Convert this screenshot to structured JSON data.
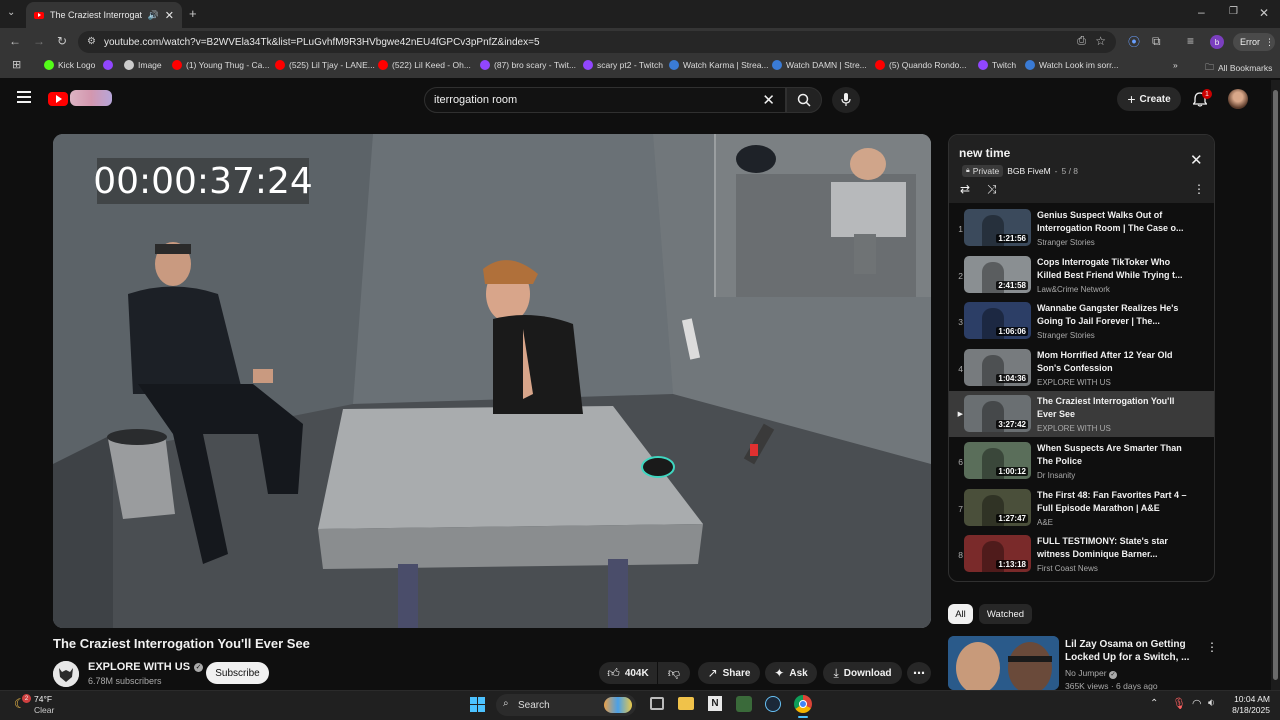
{
  "browser": {
    "tab_title": "The Craziest Interrogation Y",
    "url": "youtube.com/watch?v=B2WVEla34Tk&list=PLuGvhfM9R3HVbgwe42nEU4fGPCv3pPnfZ&index=5",
    "profile_initial": "b",
    "error_label": "Error",
    "bookmarks": [
      {
        "label": "Kick Logo",
        "color": "#53fc18"
      },
      {
        "label": "",
        "color": "#9146ff"
      },
      {
        "label": "Image",
        "color": "#cccccc"
      },
      {
        "label": "(1) Young Thug - Ca...",
        "color": "#ff0000"
      },
      {
        "label": "(525) Lil Tjay - LANE...",
        "color": "#ff0000"
      },
      {
        "label": "(522) Lil Keed - Oh...",
        "color": "#ff0000"
      },
      {
        "label": "(87) bro scary - Twit...",
        "color": "#9146ff"
      },
      {
        "label": "scary pt2 - Twitch",
        "color": "#9146ff"
      },
      {
        "label": "Watch Karma | Strea...",
        "color": "#3a7bd5"
      },
      {
        "label": "Watch DAMN | Stre...",
        "color": "#3a7bd5"
      },
      {
        "label": "(5) Quando Rondo...",
        "color": "#ff0000"
      },
      {
        "label": "Twitch",
        "color": "#9146ff"
      },
      {
        "label": "Watch Look im sorr...",
        "color": "#3a7bd5"
      }
    ],
    "all_bookmarks": "All Bookmarks"
  },
  "header": {
    "search_value": "iterrogation room",
    "create_label": "Create",
    "notif_count": "1"
  },
  "video": {
    "timestamp_overlay": "00:00:37:24",
    "title": "The Craziest Interrogation You'll Ever See",
    "channel": "EXPLORE WITH US",
    "subscribers": "6.78M subscribers",
    "subscribe_label": "Subscribe",
    "likes": "404K",
    "share_label": "Share",
    "ask_label": "Ask",
    "download_label": "Download"
  },
  "playlist": {
    "title": "new time",
    "privacy": "Private",
    "owner": "BGB FiveM",
    "position": "5 / 8",
    "items": [
      {
        "index": "1",
        "title": "Genius Suspect Walks Out of Interrogation Room | The Case o...",
        "channel": "Stranger Stories",
        "duration": "1:21:56",
        "thumb": "#3b4a5c"
      },
      {
        "index": "2",
        "title": "Cops Interrogate TikToker Who Killed Best Friend While Trying t...",
        "channel": "Law&Crime Network",
        "duration": "2:41:58",
        "thumb": "#8a8f92"
      },
      {
        "index": "3",
        "title": "Wannabe Gangster Realizes He's Going To Jail Forever | The...",
        "channel": "Stranger Stories",
        "duration": "1:06:06",
        "thumb": "#2c3e66"
      },
      {
        "index": "4",
        "title": "Mom Horrified After 12 Year Old Son's Confession",
        "channel": "EXPLORE WITH US",
        "duration": "1:04:36",
        "thumb": "#777b7e"
      },
      {
        "index": "",
        "title": "The Craziest Interrogation You'll Ever See",
        "channel": "EXPLORE WITH US",
        "duration": "3:27:42",
        "thumb": "#6a6f72",
        "active": true
      },
      {
        "index": "6",
        "title": "When Suspects Are Smarter Than The Police",
        "channel": "Dr Insanity",
        "duration": "1:00:12",
        "thumb": "#5a6e5a"
      },
      {
        "index": "7",
        "title": "The First 48: Fan Favorites Part 4 – Full Episode Marathon | A&E",
        "channel": "A&E",
        "duration": "1:27:47",
        "thumb": "#4a4f3a"
      },
      {
        "index": "8",
        "title": "FULL TESTIMONY: State's star witness Dominique Barner...",
        "channel": "First Coast News",
        "duration": "1:13:18",
        "thumb": "#7a2a2a"
      }
    ]
  },
  "filters": {
    "all": "All",
    "watched": "Watched"
  },
  "recommended": {
    "title": "Lil Zay Osama on Getting Locked Up for a Switch, ...",
    "channel": "No Jumper",
    "views": "365K views · 6 days ago"
  },
  "taskbar": {
    "temperature": "74°F",
    "weather": "Clear",
    "weather_badge": "2",
    "search_label": "Search",
    "time": "10:04 AM",
    "date": "8/18/2025"
  }
}
